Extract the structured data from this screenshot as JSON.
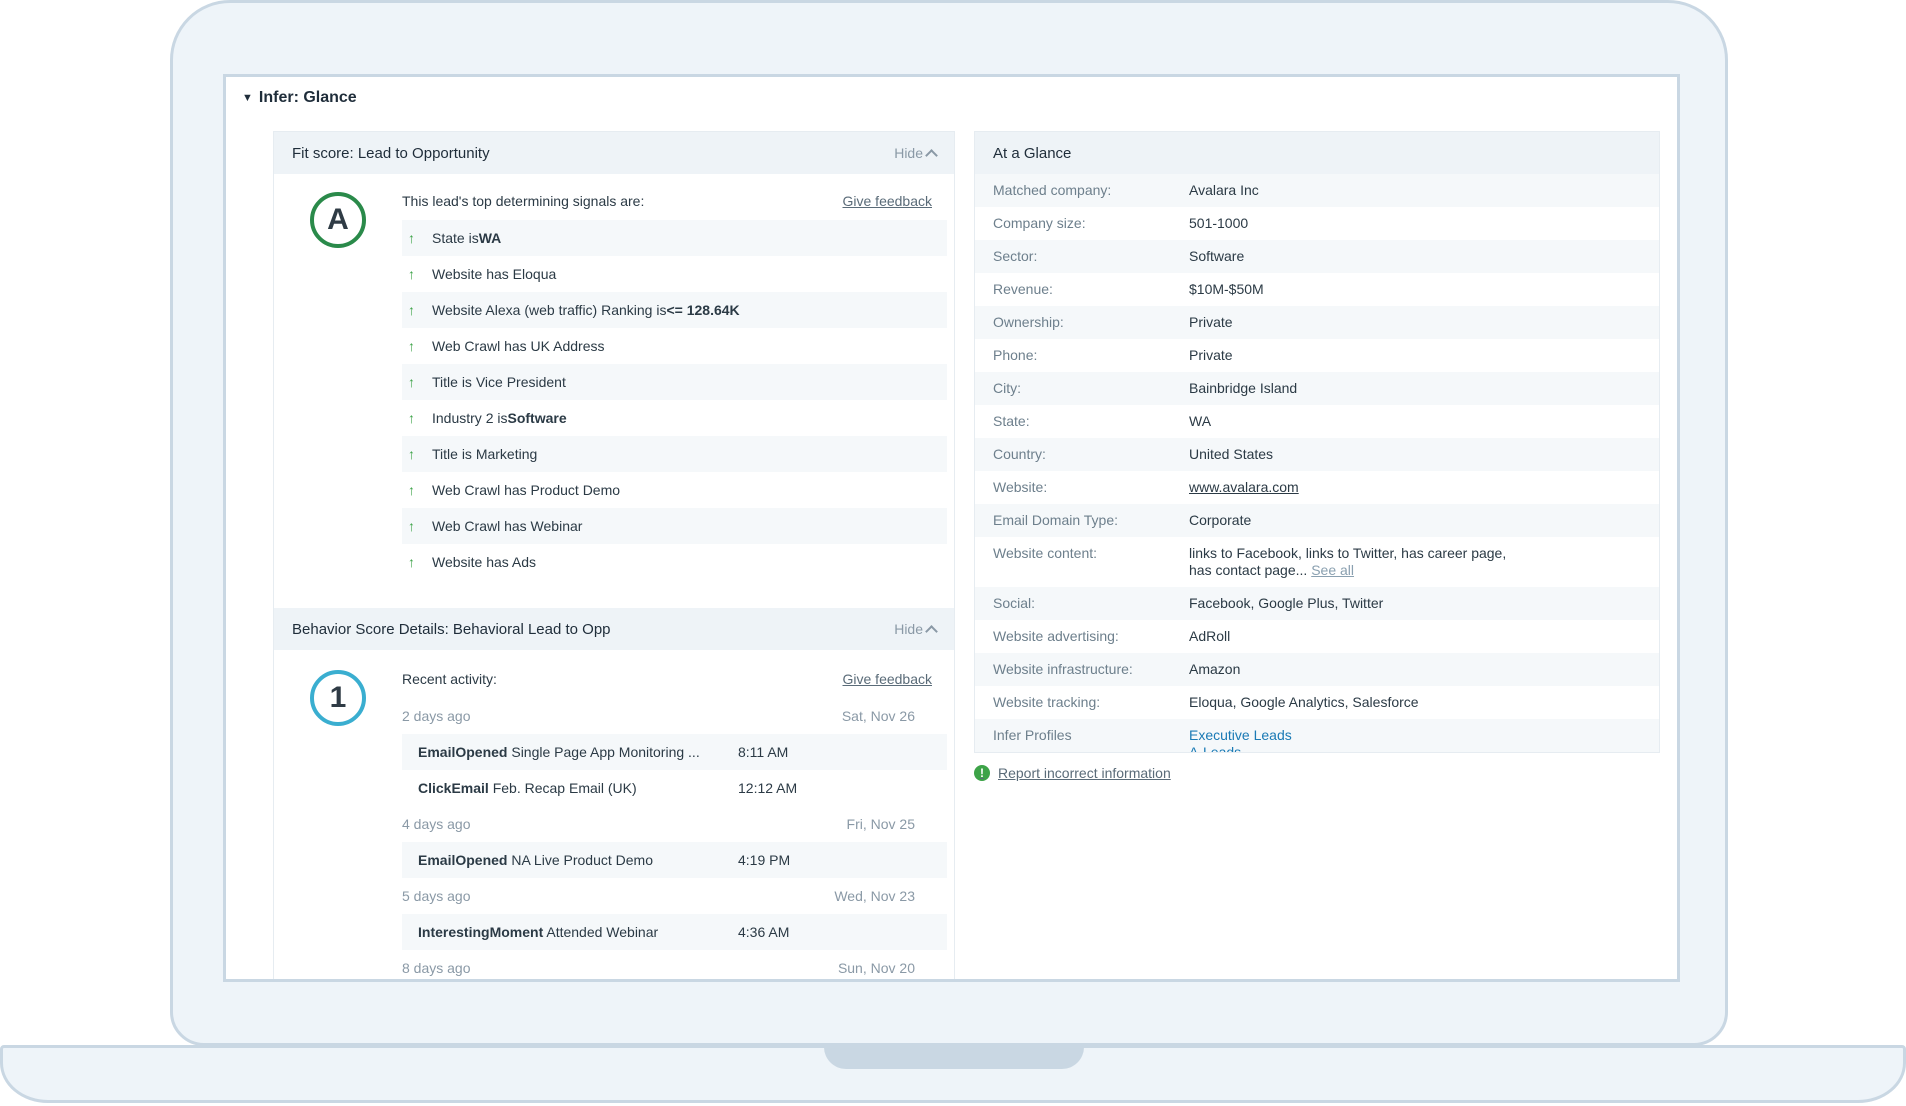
{
  "section": {
    "title": "Infer: Glance"
  },
  "fit": {
    "title": "Fit score: Lead to Opportunity",
    "hide_label": "Hide",
    "grade": "A",
    "intro": "This lead's top determining signals are:",
    "feedback": "Give feedback",
    "signals": [
      {
        "text": "State is ",
        "bold": "WA"
      },
      {
        "text": "Website has Eloqua",
        "bold": ""
      },
      {
        "text": "Website Alexa (web traffic) Ranking is ",
        "bold": "<= 128.64K"
      },
      {
        "text": "Web Crawl has UK Address",
        "bold": ""
      },
      {
        "text": "Title is Vice President",
        "bold": ""
      },
      {
        "text": "Industry 2 is ",
        "bold": "Software"
      },
      {
        "text": "Title is Marketing",
        "bold": ""
      },
      {
        "text": "Web Crawl has Product Demo",
        "bold": ""
      },
      {
        "text": "Web Crawl has Webinar",
        "bold": ""
      },
      {
        "text": "Website has Ads",
        "bold": ""
      }
    ]
  },
  "behavior": {
    "title": "Behavior Score Details: Behavioral Lead to Opp",
    "hide_label": "Hide",
    "grade": "1",
    "intro": "Recent activity:",
    "feedback": "Give feedback",
    "groups": [
      {
        "ago": "2 days ago",
        "date": "Sat, Nov 26",
        "items": [
          {
            "type": "EmailOpened",
            "desc": "Single Page App Monitoring ...",
            "time": "8:11 AM"
          },
          {
            "type": "ClickEmail",
            "desc": "Feb. Recap Email (UK)",
            "time": "12:12 AM"
          }
        ]
      },
      {
        "ago": "4 days ago",
        "date": "Fri, Nov 25",
        "items": [
          {
            "type": "EmailOpened",
            "desc": "NA Live Product Demo",
            "time": "4:19 PM"
          }
        ]
      },
      {
        "ago": "5 days ago",
        "date": "Wed, Nov 23",
        "items": [
          {
            "type": "InterestingMoment",
            "desc": "Attended Webinar",
            "time": "4:36 AM"
          }
        ]
      },
      {
        "ago": "8 days ago",
        "date": "Sun, Nov 20",
        "items": []
      }
    ]
  },
  "glance": {
    "title": "At a Glance",
    "rows": [
      {
        "label": "Matched company:",
        "value": "Avalara Inc"
      },
      {
        "label": "Company size:",
        "value": "501-1000"
      },
      {
        "label": "Sector:",
        "value": "Software"
      },
      {
        "label": "Revenue:",
        "value": "$10M-$50M"
      },
      {
        "label": "Ownership:",
        "value": "Private"
      },
      {
        "label": "Phone:",
        "value": "Private"
      },
      {
        "label": "City:",
        "value": "Bainbridge Island"
      },
      {
        "label": "State:",
        "value": "WA"
      },
      {
        "label": "Country:",
        "value": "United States"
      },
      {
        "label": "Website:",
        "value": "www.avalara.com",
        "link": true
      },
      {
        "label": "Email Domain Type:",
        "value": "Corporate"
      },
      {
        "label": "Website content:",
        "value": "links to Facebook, links to Twitter, has career page, has contact page...",
        "extra": "See all"
      },
      {
        "label": "Social:",
        "value": "Facebook, Google Plus, Twitter"
      },
      {
        "label": "Website advertising:",
        "value": "AdRoll"
      },
      {
        "label": "Website infrastructure:",
        "value": "Amazon"
      },
      {
        "label": "Website tracking:",
        "value": "Eloqua, Google Analytics, Salesforce"
      },
      {
        "label": "Infer Profiles",
        "profiles": [
          "Executive Leads",
          "A-Leads"
        ]
      }
    ]
  },
  "report": {
    "label": "Report incorrect information"
  },
  "colors": {
    "fit_badge": "#2a8a4a",
    "behavior_badge": "#3aaed0",
    "arrow": "#3da348",
    "link": "#1a7ab5"
  }
}
